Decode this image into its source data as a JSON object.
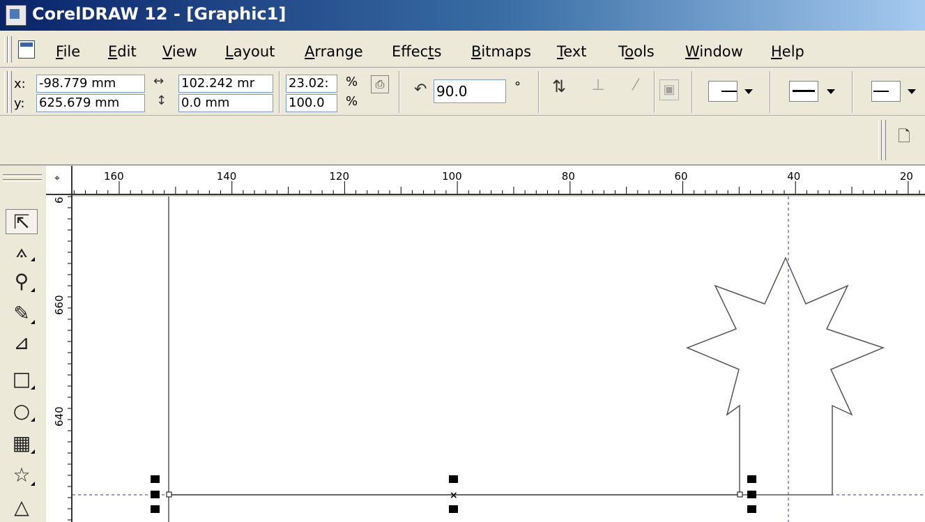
{
  "window": {
    "title": "CorelDRAW 12 - [Graphic1]"
  },
  "menu": {
    "items": [
      "File",
      "Edit",
      "View",
      "Layout",
      "Arrange",
      "Effects",
      "Bitmaps",
      "Text",
      "Tools",
      "Window",
      "Help"
    ],
    "underline_index": [
      0,
      0,
      0,
      0,
      0,
      5,
      0,
      0,
      1,
      0,
      0
    ]
  },
  "propbar": {
    "x_label": "x:",
    "x_value": "-98.779 mm",
    "y_label": "y:",
    "y_value": "625.679 mm",
    "width_value": "102.242 mr",
    "height_value": "0.0 mm",
    "scale_x": "23.02:",
    "scale_y": "100.0",
    "percent_x": "%",
    "percent_y": "%",
    "rotation_value": "90.0",
    "degree_symbol": "°"
  },
  "hruler": {
    "labels": [
      "160",
      "140",
      "120",
      "100",
      "80",
      "60",
      "40",
      "20"
    ]
  },
  "vruler": {
    "labels": [
      "660",
      "640"
    ],
    "top_partial": "6"
  },
  "colors": {
    "accent": "#0a246a",
    "guideline": "#3030a0"
  },
  "icons": {
    "tools": [
      "pick-tool-icon",
      "shape-tool-icon",
      "zoom-tool-icon",
      "freehand-tool-icon",
      "smart-fill-tool-icon",
      "rectangle-tool-icon",
      "ellipse-tool-icon",
      "graph-paper-tool-icon",
      "star-tool-icon",
      "basic-shapes-tool-icon"
    ]
  }
}
